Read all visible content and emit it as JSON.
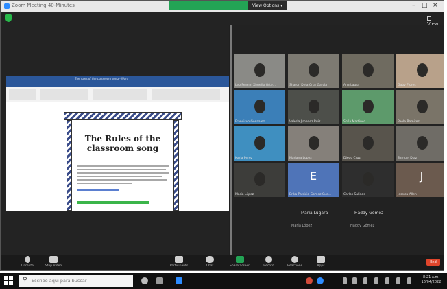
{
  "window": {
    "title": "Zoom Meeting 40-Minutes",
    "view_options": "View Options ▾",
    "view_label": "View",
    "controls": [
      "–",
      "□",
      "×"
    ]
  },
  "shared_doc": {
    "doc_title": "The rules of the classroom song - Word",
    "ribbon_tabs": [
      "File",
      "Home",
      "Insert",
      "Design",
      "Layout",
      "References",
      "Mailings",
      "Review",
      "View"
    ],
    "song_title": "The Rules of the classroom song"
  },
  "gallery": {
    "tiles": [
      {
        "name": "Leo Fermin Ximeño Orte...",
        "bg": "#8a8a86",
        "kind": "video"
      },
      {
        "name": "Sharon Dela Cruz Garcia",
        "bg": "#7d7a72",
        "kind": "video"
      },
      {
        "name": "Ana Laura",
        "bg": "#6f6b60",
        "kind": "video"
      },
      {
        "name": "Gaby Flores",
        "bg": "#b8a18a",
        "kind": "video"
      },
      {
        "name": "Francisco Gonzalez",
        "bg": "#3b7fb8",
        "kind": "video"
      },
      {
        "name": "Valeria Jimenez Ruiz",
        "bg": "#4d4f4a",
        "kind": "video"
      },
      {
        "name": "Sofia Martinez",
        "bg": "#5d9a6b",
        "kind": "video"
      },
      {
        "name": "Paola Ramirez",
        "bg": "#7a7468",
        "kind": "video"
      },
      {
        "name": "Karla Perez",
        "bg": "#3f8fc0",
        "kind": "video"
      },
      {
        "name": "Mariana Lopez",
        "bg": "#85807a",
        "kind": "video"
      },
      {
        "name": "Diego Cruz",
        "bg": "#58544c",
        "kind": "video"
      },
      {
        "name": "Samuel Diaz",
        "bg": "#6f6c66",
        "kind": "video"
      },
      {
        "name": "Maria López",
        "bg": "#3d3d3a",
        "kind": "video"
      },
      {
        "name": "Erika Patricia Gomez Cue...",
        "bg": "#4f74b8",
        "kind": "initial",
        "initial": "E"
      },
      {
        "name": "Carlos Salinas",
        "bg": "#2e2e2e",
        "kind": "video"
      },
      {
        "name": "Jessica Allen",
        "bg": "#6b5a4e",
        "kind": "initial",
        "initial": "J"
      }
    ],
    "audio_only": [
      {
        "name": "María Lugara",
        "sub": "María López"
      },
      {
        "name": "Haddy Gomez",
        "sub": "Haddy Gómez"
      }
    ]
  },
  "toolbar": {
    "buttons": [
      {
        "label": "Unmute",
        "icon": "microphone-icon"
      },
      {
        "label": "Stop Video",
        "icon": "video-camera-icon"
      },
      {
        "label": "Participants",
        "icon": "participants-icon",
        "count": "24"
      },
      {
        "label": "Chat",
        "icon": "chat-icon"
      },
      {
        "label": "Share Screen",
        "icon": "share-screen-icon"
      },
      {
        "label": "Record",
        "icon": "record-icon"
      },
      {
        "label": "Reactions",
        "icon": "reactions-icon"
      },
      {
        "label": "Apps",
        "icon": "apps-icon"
      }
    ],
    "end_label": "End"
  },
  "taskbar": {
    "search_placeholder": "Escribe aquí para buscar",
    "time": "8:21 a.m.",
    "date": "16/04/2022"
  },
  "colors": {
    "share_banner": "#23a455",
    "word_blue": "#2b579a",
    "end_red": "#e0452b"
  }
}
